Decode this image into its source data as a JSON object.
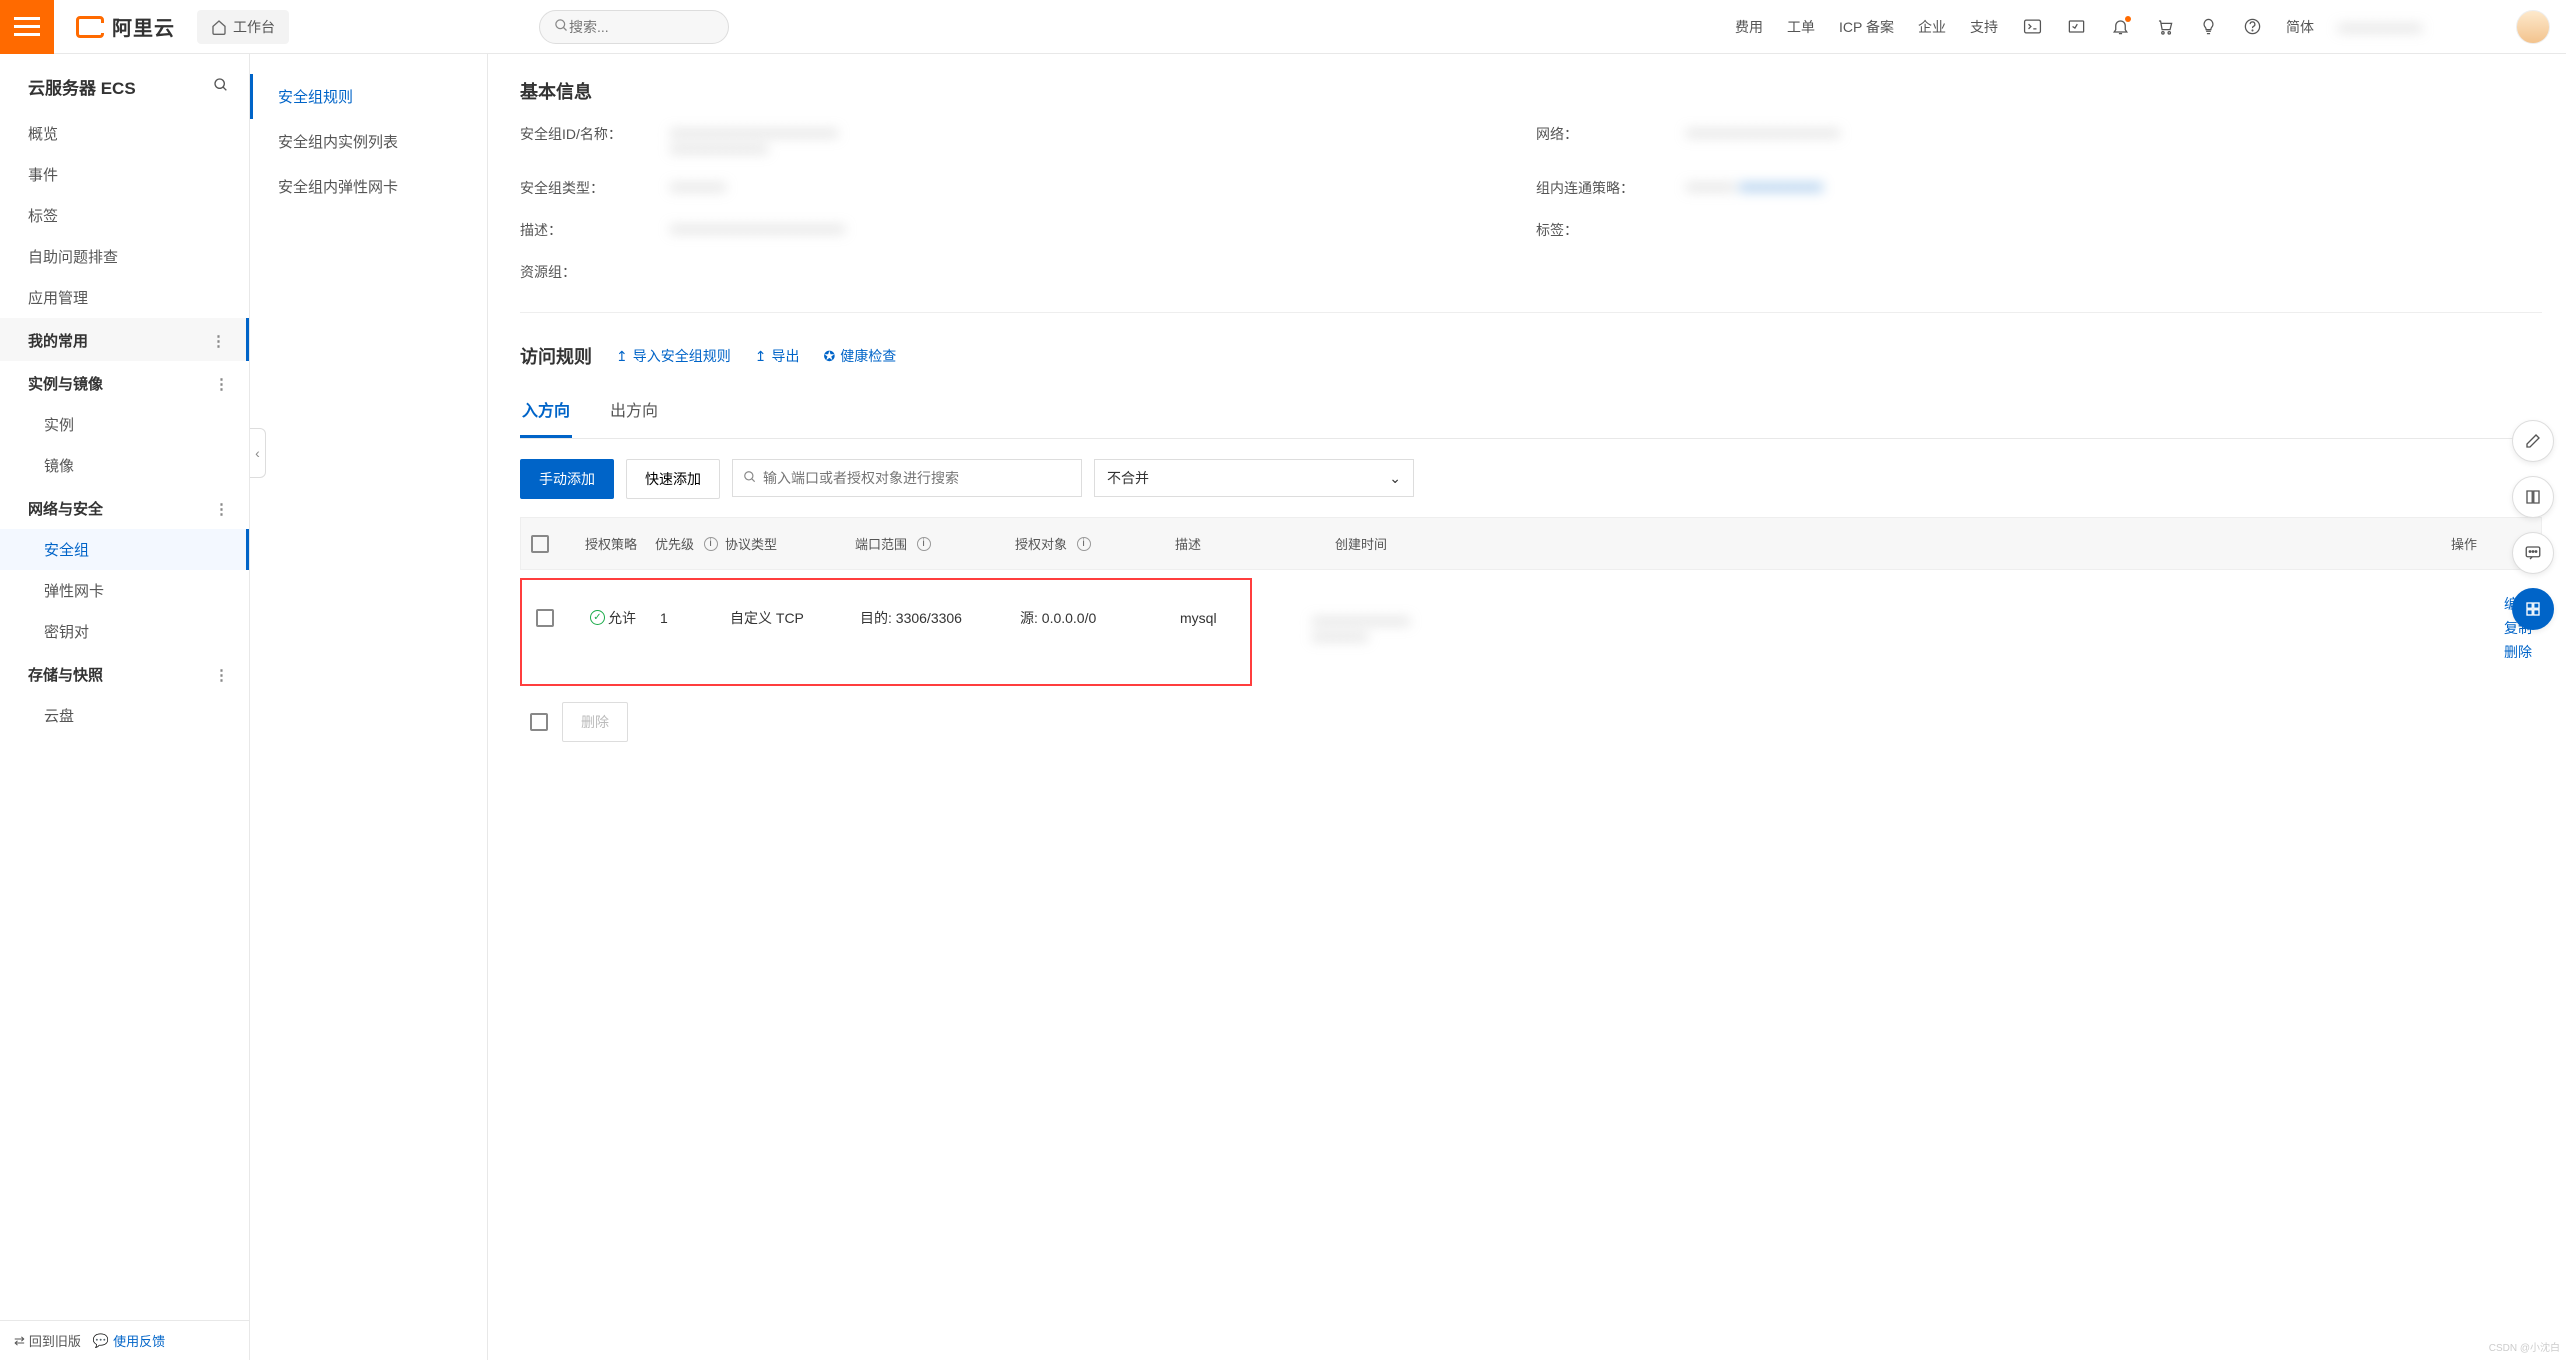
{
  "topbar": {
    "brand": "阿里云",
    "workbench": "工作台",
    "search_placeholder": "搜索...",
    "links": [
      "费用",
      "工单",
      "ICP 备案",
      "企业",
      "支持"
    ],
    "lang": "简体"
  },
  "sidebar1": {
    "title": "云服务器 ECS",
    "items": [
      "概览",
      "事件",
      "标签",
      "自助问题排查",
      "应用管理"
    ],
    "my_frequent": "我的常用",
    "groups": [
      {
        "title": "实例与镜像",
        "items": [
          "实例",
          "镜像"
        ]
      },
      {
        "title": "网络与安全",
        "items": [
          "安全组",
          "弹性网卡",
          "密钥对"
        ],
        "active": "安全组"
      },
      {
        "title": "存储与快照",
        "items": [
          "云盘"
        ]
      }
    ],
    "footer": {
      "back": "回到旧版",
      "feedback": "使用反馈"
    }
  },
  "sidebar2": {
    "items": [
      "安全组规则",
      "安全组内实例列表",
      "安全组内弹性网卡"
    ],
    "active": "安全组规则"
  },
  "basic_info": {
    "title": "基本信息",
    "rows": [
      {
        "label1": "安全组ID/名称：",
        "label2": "网络："
      },
      {
        "label1": "安全组类型：",
        "label2": "组内连通策略："
      },
      {
        "label1": "描述：",
        "label2": "标签："
      },
      {
        "label1": "资源组：",
        "label2": ""
      }
    ]
  },
  "rules": {
    "title": "访问规则",
    "actions": {
      "import": "导入安全组规则",
      "export": "导出",
      "health": "健康检查"
    },
    "tabs": [
      "入方向",
      "出方向"
    ],
    "active_tab": "入方向",
    "buttons": {
      "manual": "手动添加",
      "quick": "快速添加"
    },
    "search_placeholder": "输入端口或者授权对象进行搜索",
    "merge_select": "不合并",
    "columns": [
      "授权策略",
      "优先级",
      "协议类型",
      "端口范围",
      "授权对象",
      "描述",
      "创建时间",
      "操作"
    ],
    "row": {
      "policy": "允许",
      "priority": "1",
      "protocol": "自定义 TCP",
      "port": "目的: 3306/3306",
      "source": "源: 0.0.0.0/0",
      "desc": "mysql",
      "actions": [
        "编辑",
        "复制",
        "删除"
      ]
    },
    "footer_delete": "删除"
  },
  "watermark": "CSDN @小沈白"
}
